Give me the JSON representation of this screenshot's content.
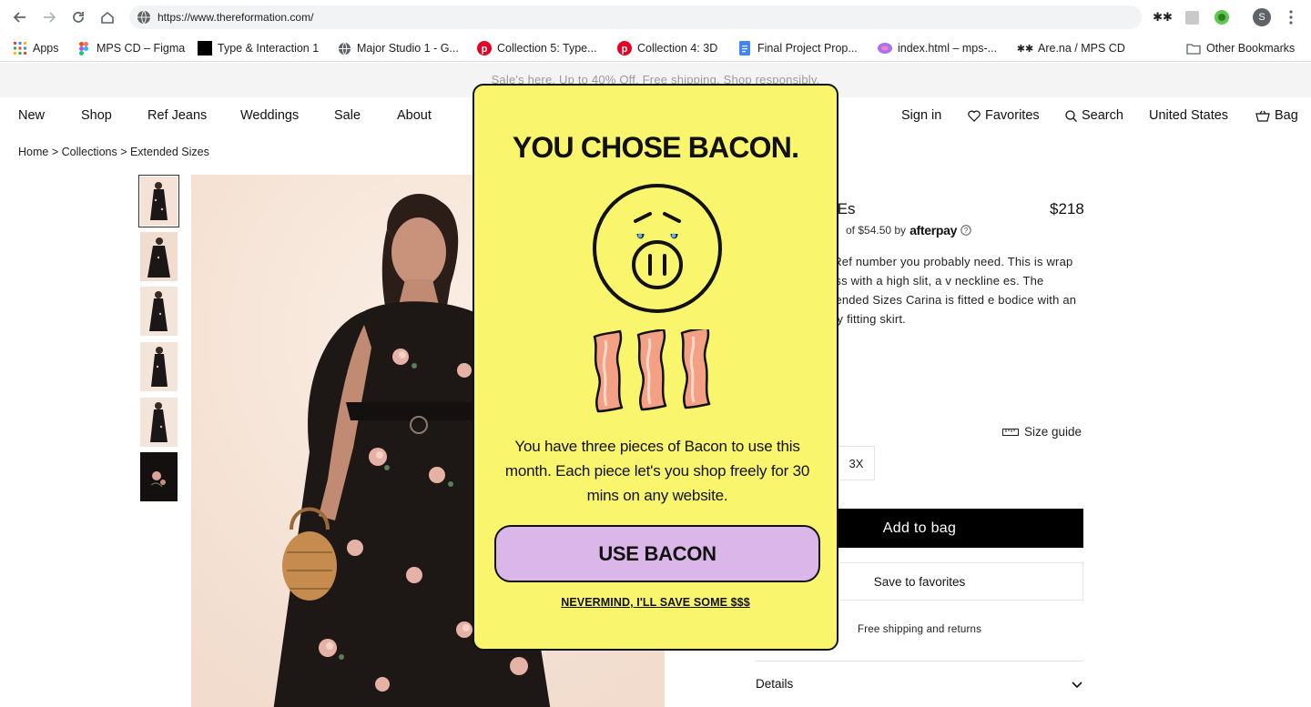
{
  "browser": {
    "url": "https://www.thereformation.com/",
    "bookmarks": [
      {
        "label": "Apps",
        "icon": "apps-grid-icon"
      },
      {
        "label": "MPS CD – Figma",
        "icon": "figma-icon"
      },
      {
        "label": "Type & Interaction 1",
        "icon": "black-square-icon"
      },
      {
        "label": "Major Studio 1 - G...",
        "icon": "globe-icon"
      },
      {
        "label": "Collection 5: Type...",
        "icon": "pinterest-icon"
      },
      {
        "label": "Collection 4: 3D",
        "icon": "pinterest-icon"
      },
      {
        "label": "Final Project Prop...",
        "icon": "google-docs-icon"
      },
      {
        "label": "index.html – mps-...",
        "icon": "glitch-icon"
      },
      {
        "label": "Are.na / MPS CD",
        "icon": "arena-icon"
      },
      {
        "label": "Other Bookmarks",
        "icon": "folder-icon"
      }
    ],
    "profile_initial": "S"
  },
  "site": {
    "announcement": "Sale's here. Up to 40% Off. Free shipping. Shop responsibly.",
    "nav_left": [
      "New",
      "Shop",
      "Ref Jeans",
      "Weddings",
      "Sale",
      "About"
    ],
    "nav_right": {
      "signin": "Sign in",
      "favorites": "Favorites",
      "search": "Search",
      "country": "United States",
      "bag": "Bag"
    },
    "breadcrumb": "Home > Collections > Extended Sizes"
  },
  "product": {
    "title_partial": "ss Es",
    "price": "$218",
    "installment": "of $54.50 by",
    "afterpay_brand": "afterpay",
    "description": "sy Ref number you probably need. This is wrap dress with a high slit, a v neckline es. The Extended Sizes Carina is fitted e bodice with an easy fitting skirt.",
    "size_guide": "Size guide",
    "size_option": "3X",
    "add_to_bag": "Add to bag",
    "save_favorites": "Save to favorites",
    "shipping": "Free shipping and returns",
    "details": "Details"
  },
  "modal": {
    "title": "YOU CHOSE BACON.",
    "body": "You have three pieces of Bacon to use this month. Each piece let's you shop freely for 30 mins on any website.",
    "primary_button": "USE BACON",
    "secondary_link": "NEVERMIND, I'LL SAVE SOME $$$",
    "colors": {
      "background": "#f9f56c",
      "button": "#dbb7e9",
      "bacon": "#f3a084"
    }
  }
}
